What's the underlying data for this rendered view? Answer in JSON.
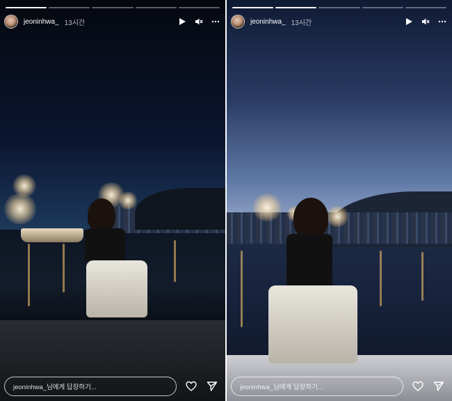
{
  "stories": [
    {
      "username": "jeoninhwa_",
      "time": "13시간",
      "reply_placeholder": "jeoninhwa_님에게 답장하기...",
      "progress": [
        1,
        0,
        0,
        0,
        0
      ],
      "icons": [
        "play-icon",
        "mute-icon",
        "more-icon",
        "heart-icon",
        "send-icon"
      ]
    },
    {
      "username": "jeoninhwa_",
      "time": "13시간",
      "reply_placeholder": "jeoninhwa_님에게 답장하기...",
      "progress": [
        1,
        1,
        0,
        0,
        0
      ],
      "icons": [
        "play-icon",
        "mute-icon",
        "more-icon",
        "heart-icon",
        "send-icon"
      ]
    }
  ]
}
